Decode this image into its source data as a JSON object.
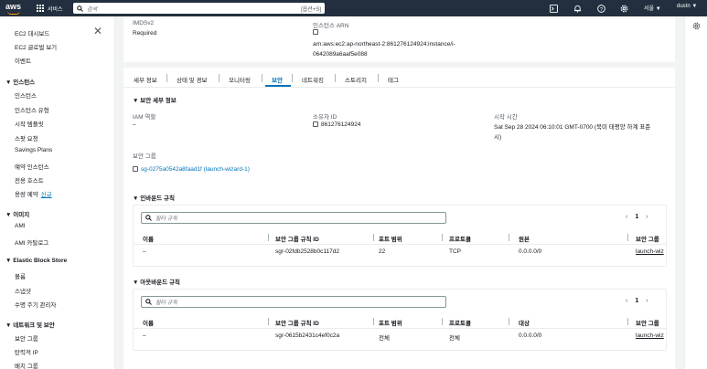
{
  "topbar": {
    "logo": "aws",
    "services_label": "서비스",
    "search_placeholder": "검색",
    "search_shortcut": "[옵션+S]",
    "region": "서울 ▼",
    "user": "dustn ▼"
  },
  "sidebar": {
    "top_items": [
      "EC2 대시보드",
      "EC2 글로벌 보기",
      "이벤트"
    ],
    "sections": [
      {
        "title": "▼ 인스턴스",
        "items": [
          "인스턴스",
          "인스턴스 유형",
          "시작 템플릿",
          "스팟 요청",
          "Savings Plans",
          "예약 인스턴스",
          "전용 호스트",
          "용량 예약"
        ],
        "new_badge": "신규"
      },
      {
        "title": "▼ 이미지",
        "items": [
          "AMI",
          "AMI 카탈로그"
        ]
      },
      {
        "title": "▼ Elastic Block Store",
        "items": [
          "볼륨",
          "스냅샷",
          "수명 주기 관리자"
        ]
      },
      {
        "title": "▼ 네트워크 및 보안",
        "items": [
          "보안 그룹",
          "탄력적 IP",
          "배치 그룹"
        ]
      }
    ]
  },
  "summary": {
    "imds_label": "IMDSv2",
    "imds_value": "Required",
    "arn_label": "인스턴스 ARN",
    "arn_line1": "arn:aws:ec2:ap-northeast-2:861276124924:instance/i-",
    "arn_line2": "0642089a6aaf5e088"
  },
  "tabs": [
    "세부 정보",
    "상태 및 경보",
    "모니터링",
    "보안",
    "네트워킹",
    "스토리지",
    "태그"
  ],
  "active_tab": "보안",
  "security_details": {
    "section_title": "▼ 보안 세부 정보",
    "iam_label": "IAM 역할",
    "iam_value": "–",
    "owner_label": "소유자 ID",
    "owner_value": "861276124924",
    "launch_label": "시작 시간",
    "launch_value_line1": "Sat Sep 28 2024 06:10:01 GMT-0700 (북미 태평양 하계 표준",
    "launch_value_line2": "시)",
    "sg_label": "보안 그룹",
    "sg_value": "sg-0275a0542a8faad1f (launch-wizard-1)"
  },
  "inbound": {
    "title": "▼ 인바운드 규칙",
    "filter_placeholder": "필터 규칙",
    "page": "1",
    "columns": [
      "이름",
      "보안 그룹 규칙 ID",
      "포트 범위",
      "프로토콜",
      "원본",
      "보안 그룹"
    ],
    "rows": [
      [
        "–",
        "sgr-02fdb2528b0c117d2",
        "22",
        "TCP",
        "0.0.0.0/0",
        "launch-wiz"
      ]
    ]
  },
  "outbound": {
    "title": "▼ 아웃바운드 규칙",
    "filter_placeholder": "필터 규칙",
    "page": "1",
    "columns": [
      "이름",
      "보안 그룹 규칙 ID",
      "포트 범위",
      "프로토콜",
      "대상",
      "보안 그룹"
    ],
    "rows": [
      [
        "–",
        "sgr-0615b2431c4ef0c2a",
        "전체",
        "전체",
        "0.0.0.0/0",
        "launch-wiz"
      ]
    ]
  },
  "colors": {
    "topbar": "#232f3e",
    "accent": "#ff9900",
    "link": "#0073bb"
  }
}
